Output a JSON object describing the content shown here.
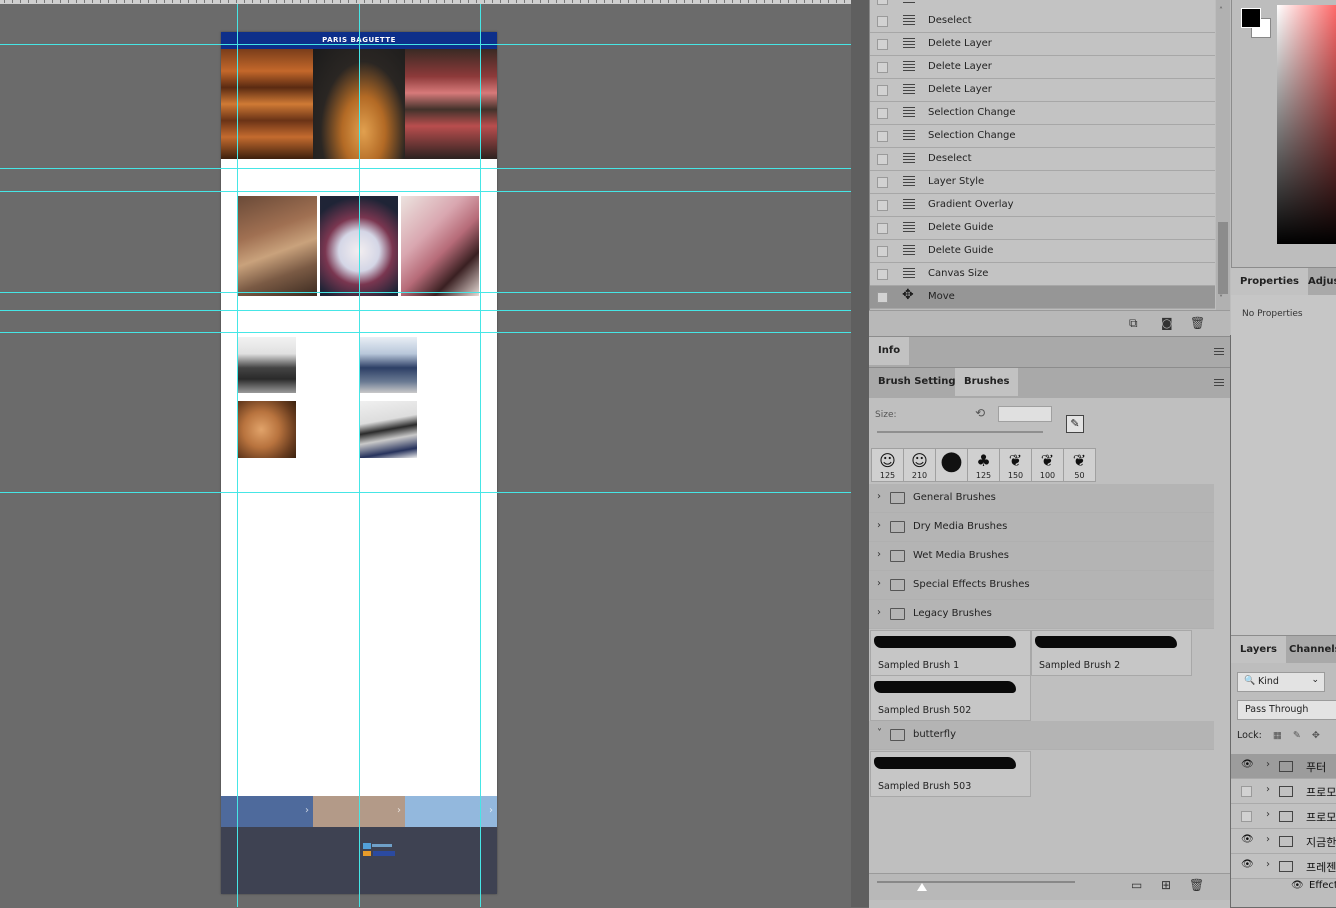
{
  "document": {
    "header_title": "PARIS BAGUETTE"
  },
  "history": {
    "items": [
      {
        "label": "Deselect"
      },
      {
        "label": "Delete Layer"
      },
      {
        "label": "Delete Layer"
      },
      {
        "label": "Delete Layer"
      },
      {
        "label": "Selection Change"
      },
      {
        "label": "Selection Change"
      },
      {
        "label": "Deselect"
      },
      {
        "label": "Layer Style"
      },
      {
        "label": "Gradient Overlay"
      },
      {
        "label": "Delete Guide"
      },
      {
        "label": "Delete Guide"
      },
      {
        "label": "Canvas Size"
      },
      {
        "label": "Move"
      }
    ],
    "footer_icons": [
      "new-document-from-state-icon",
      "camera-icon",
      "trash-icon"
    ]
  },
  "info_panel": {
    "tab": "Info"
  },
  "brushes_panel": {
    "tabs": [
      "Brush Settings",
      "Brushes"
    ],
    "size_label": "Size:",
    "presets": [
      {
        "icon": "face-brush-icon",
        "size": "125"
      },
      {
        "icon": "face-brush-icon",
        "size": "210"
      },
      {
        "icon": "round-brush-icon",
        "size": ""
      },
      {
        "icon": "leaf-brush-icon",
        "size": "125"
      },
      {
        "icon": "butterfly-brush-icon",
        "size": "150"
      },
      {
        "icon": "butterfly-brush-icon",
        "size": "100"
      },
      {
        "icon": "butterfly-brush-icon",
        "size": "50"
      }
    ],
    "groups": [
      "General Brushes",
      "Dry Media Brushes",
      "Wet Media Brushes",
      "Special Effects Brushes",
      "Legacy Brushes"
    ],
    "sampled": [
      "Sampled Brush 1",
      "Sampled Brush 2",
      "Sampled Brush 502"
    ],
    "butterfly_group": "butterfly",
    "butterfly_items": [
      "Sampled Brush 503"
    ]
  },
  "properties_panel": {
    "tabs": [
      "Properties",
      "Adjust"
    ],
    "empty_text": "No Properties"
  },
  "layers_panel": {
    "tabs": [
      "Layers",
      "Channels"
    ],
    "filter_kind": "Kind",
    "blend_mode": "Pass Through",
    "lock_label": "Lock:",
    "layers": [
      {
        "name": "푸터",
        "visible": true
      },
      {
        "name": "프로모",
        "visible": false
      },
      {
        "name": "프로모",
        "visible": false
      },
      {
        "name": "지금한",
        "visible": true
      },
      {
        "name": "프레젠",
        "visible": true
      }
    ],
    "effect_label": "Effect"
  },
  "colors": {
    "foreground": "#000000",
    "background": "#ffffff",
    "guide": "#46e6e6",
    "doc_header": "#0d2f8a"
  }
}
